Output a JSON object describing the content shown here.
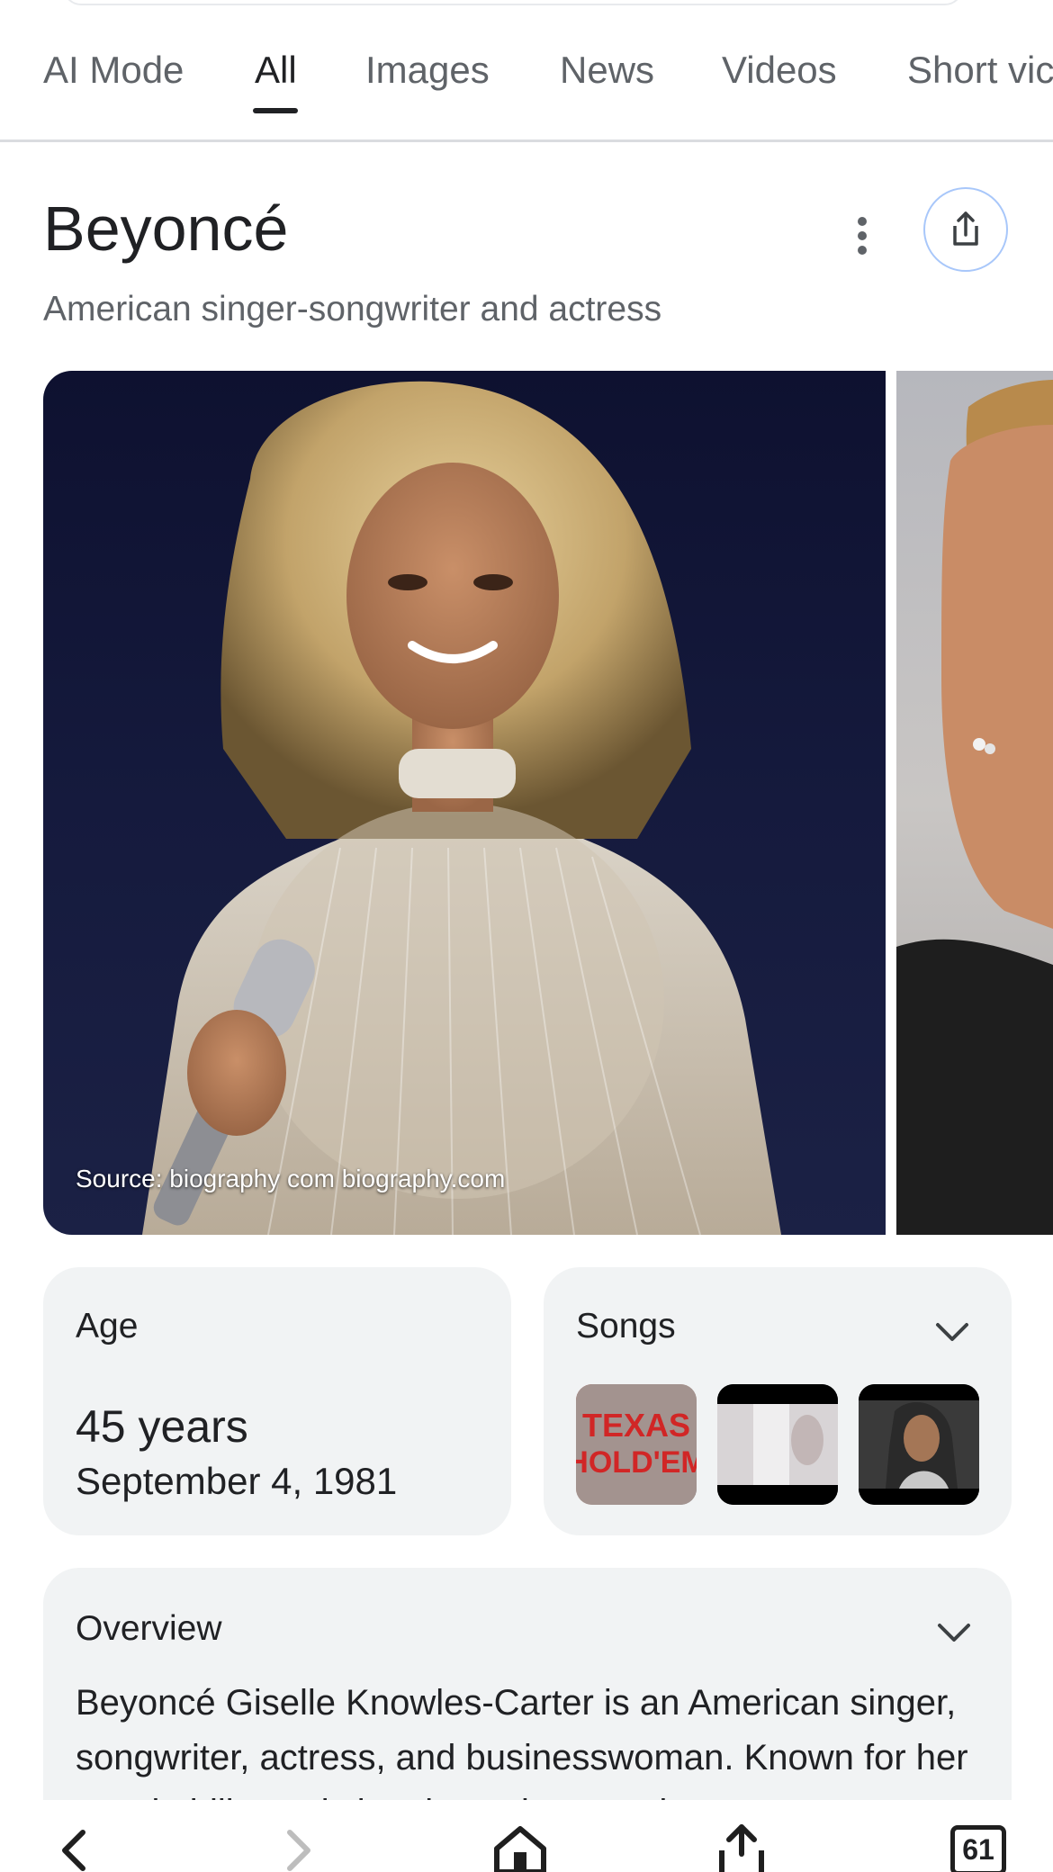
{
  "tabs": [
    {
      "label": "AI Mode"
    },
    {
      "label": "All",
      "active": true
    },
    {
      "label": "Images"
    },
    {
      "label": "News"
    },
    {
      "label": "Videos"
    },
    {
      "label": "Short vic"
    }
  ],
  "entity": {
    "title": "Beyoncé",
    "subtitle": "American singer-songwriter and actress"
  },
  "images": {
    "source": "Source: biography com biography.com"
  },
  "age_card": {
    "label": "Age",
    "value": "45 years",
    "date": "September 4, 1981"
  },
  "songs_card": {
    "label": "Songs",
    "thumb1_text": "TEXAS HOLD'EM",
    "thumbs": [
      "TEXAS HOLD 'EM thumbnail",
      "music video thumbnail",
      "music video thumbnail"
    ]
  },
  "overview_card": {
    "label": "Overview",
    "text": "Beyoncé Giselle Knowles-Carter is an American singer, songwriter, actress, and businesswoman. Known for her vocal ability, artistic reinventions, and"
  },
  "toolbar": {
    "tab_count": "61"
  },
  "colors": {
    "accent_ring": "#a8c7fa",
    "card_bg": "#f1f3f4",
    "text_primary": "#202124",
    "text_secondary": "#5f6368"
  }
}
